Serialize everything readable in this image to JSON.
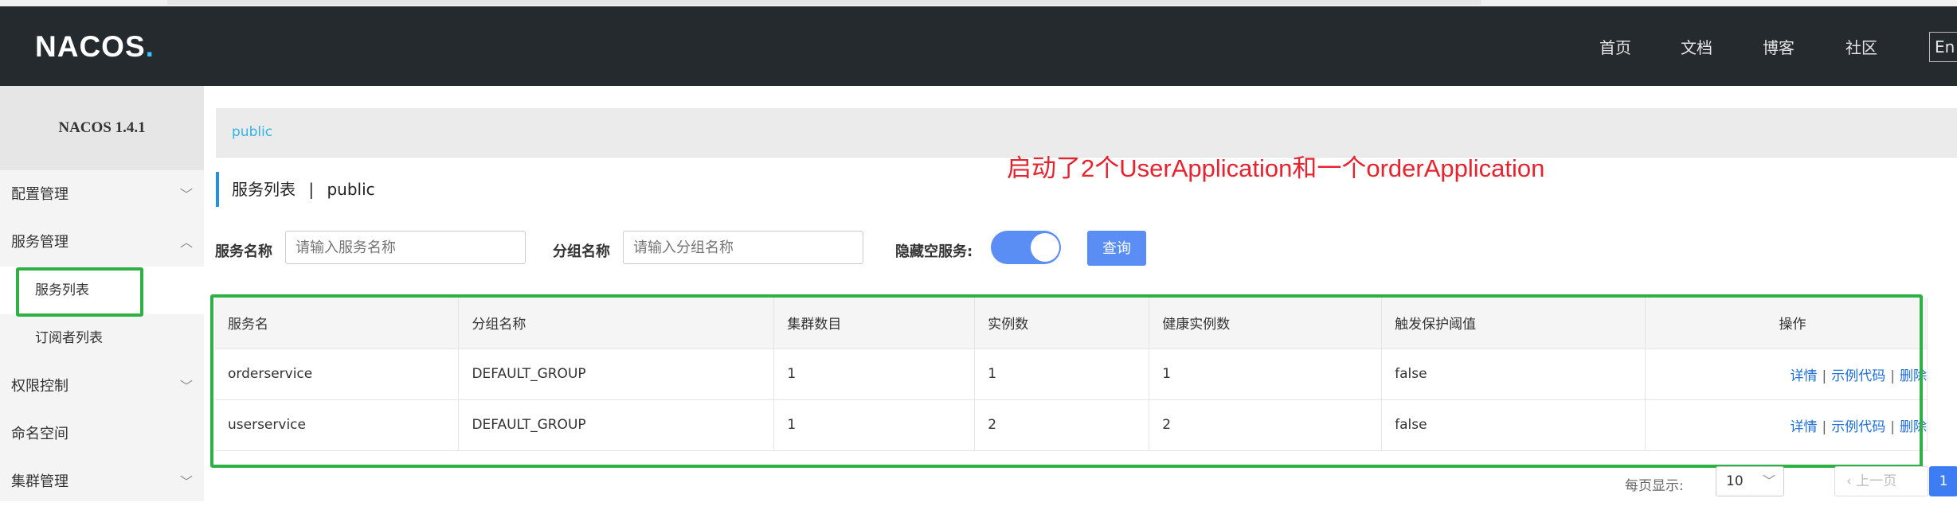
{
  "app": {
    "logo_prefix": "NACOS",
    "logo_suffix": ".",
    "version": "NACOS 1.4.1"
  },
  "topnav": {
    "links": [
      "首页",
      "文档",
      "博客",
      "社区"
    ],
    "lang": "En"
  },
  "sidebar": {
    "items": [
      {
        "label": "配置管理",
        "chevron": "chevron-down-icon"
      },
      {
        "label": "服务管理",
        "chevron": "chevron-up-icon"
      },
      {
        "label": "服务列表"
      },
      {
        "label": "订阅者列表"
      },
      {
        "label": "权限控制",
        "chevron": "chevron-down-icon"
      },
      {
        "label": "命名空间"
      },
      {
        "label": "集群管理",
        "chevron": "chevron-down-icon"
      }
    ]
  },
  "namespace": {
    "current": "public"
  },
  "annotation": "启动了2个UserApplication和一个orderApplication",
  "page": {
    "title": "服务列表",
    "separator": "|",
    "namespace": "public"
  },
  "filters": {
    "service_name_label": "服务名称",
    "service_name_placeholder": "请输入服务名称",
    "group_name_label": "分组名称",
    "group_name_placeholder": "请输入分组名称",
    "hide_empty_label": "隐藏空服务:",
    "hide_empty_on": true,
    "query_label": "查询"
  },
  "table": {
    "headers": [
      "服务名",
      "分组名称",
      "集群数目",
      "实例数",
      "健康实例数",
      "触发保护阈值",
      "操作"
    ],
    "rows": [
      [
        "orderservice",
        "DEFAULT_GROUP",
        "1",
        "1",
        "1",
        "false"
      ],
      [
        "userservice",
        "DEFAULT_GROUP",
        "1",
        "2",
        "2",
        "false"
      ]
    ],
    "actions": [
      "详情",
      "示例代码",
      "删除"
    ]
  },
  "pagination": {
    "per_page_label": "每页显示:",
    "per_page_value": "10",
    "prev_label": "上一页",
    "current_page": "1"
  },
  "colors": {
    "nav_bg": "#252a2f",
    "accent_blue": "#5a8ef5",
    "annotation_red": "#e6232e",
    "highlight_green": "#2eb045",
    "link_blue": "#2070d8"
  }
}
